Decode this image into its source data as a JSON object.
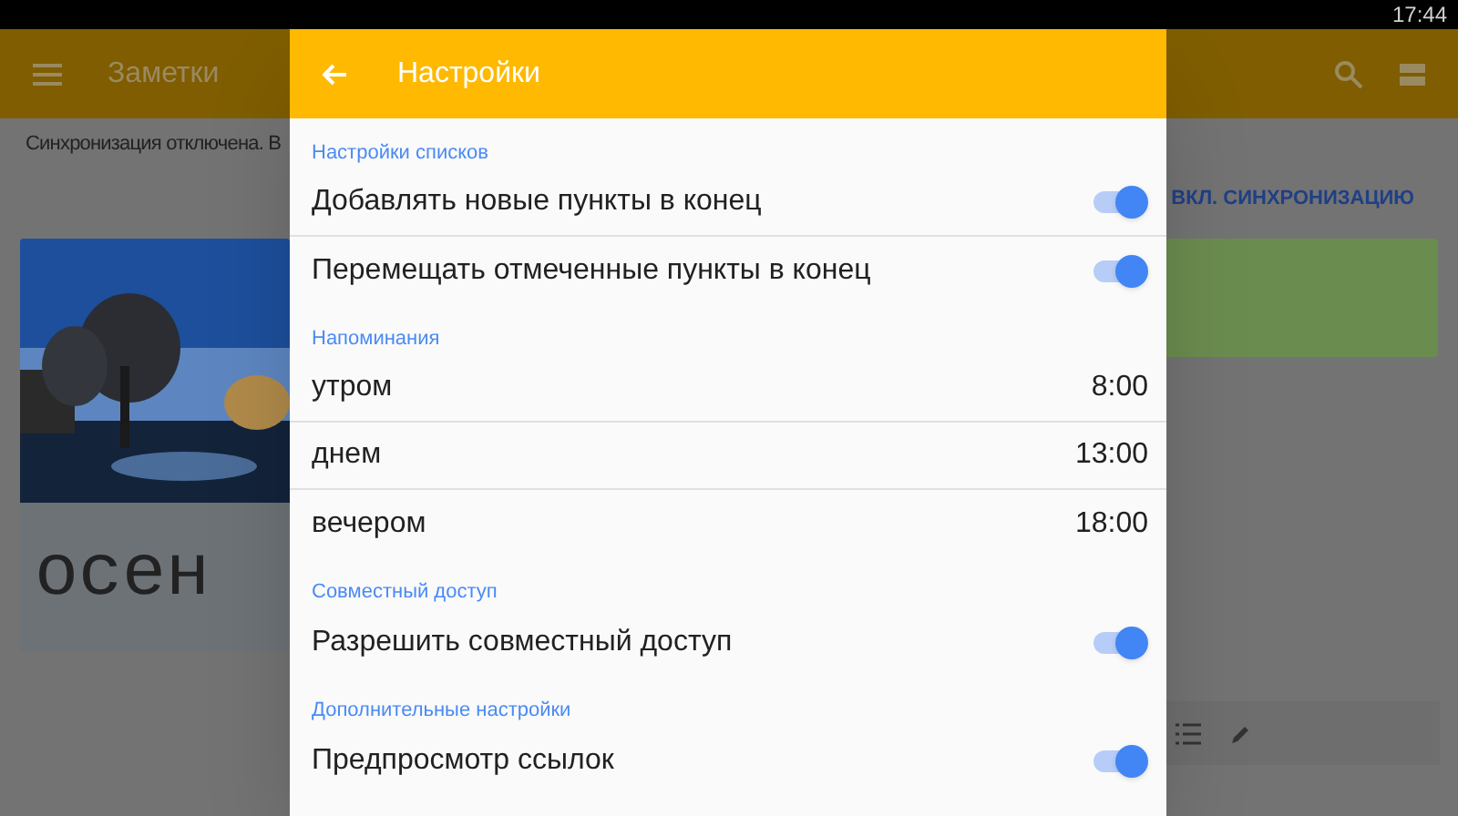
{
  "status_bar": {
    "time": "17:44"
  },
  "app_bar": {
    "title": "Заметки"
  },
  "sync_notice": {
    "text": "Синхронизация отключена. В",
    "action": "ВКЛ. СИНХРОНИЗАЦИЮ"
  },
  "notes": [
    {
      "kind": "picture",
      "text": "осен"
    },
    {
      "kind": "color",
      "color": "#6b8c4f"
    }
  ],
  "settings": {
    "title": "Настройки",
    "sections": [
      {
        "title": "Настройки списков",
        "items": [
          {
            "kind": "switch",
            "label": "Добавлять новые пункты в конец",
            "on": true
          },
          {
            "kind": "switch",
            "label": "Перемещать отмеченные пункты в конец",
            "on": true
          }
        ]
      },
      {
        "title": "Напоминания",
        "items": [
          {
            "kind": "time",
            "label": "утром",
            "value": "8:00"
          },
          {
            "kind": "time",
            "label": "днем",
            "value": "13:00"
          },
          {
            "kind": "time",
            "label": "вечером",
            "value": "18:00"
          }
        ]
      },
      {
        "title": "Совместный доступ",
        "items": [
          {
            "kind": "switch",
            "label": "Разрешить совместный доступ",
            "on": true
          }
        ]
      },
      {
        "title": "Дополнительные настройки",
        "items": [
          {
            "kind": "switch",
            "label": "Предпросмотр ссылок",
            "on": true
          }
        ]
      }
    ]
  }
}
